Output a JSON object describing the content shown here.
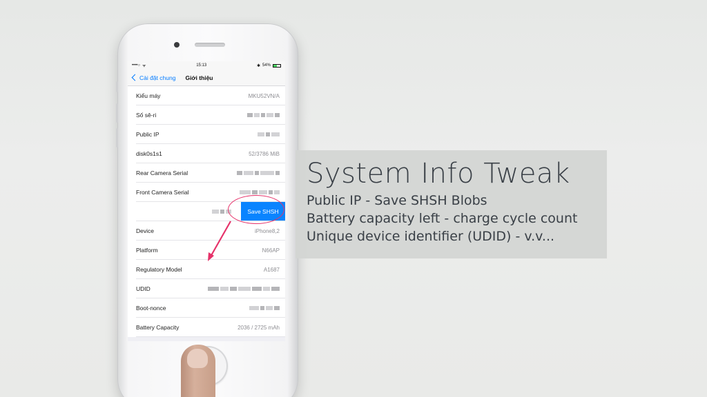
{
  "status_bar": {
    "signal": "••••○",
    "wifi": "ᯤ",
    "time": "15:13",
    "battery_percent": "54%",
    "battery_level": 0.54
  },
  "navbar": {
    "back_label": "Cài đặt chung",
    "title": "Giới thiệu"
  },
  "rows": [
    {
      "label": "Kiểu máy",
      "value": "MKU52VN/A"
    },
    {
      "label": "Số sê-ri",
      "value": ""
    },
    {
      "label": "Public IP",
      "value": ""
    },
    {
      "label": "disk0s1s1",
      "value": "52/3786 MiB"
    },
    {
      "label": "Rear Camera Serial",
      "value": ""
    },
    {
      "label": "Front Camera Serial",
      "value": ""
    },
    {
      "label": "",
      "value": ""
    },
    {
      "label": "Device",
      "value": "iPhone8,2"
    },
    {
      "label": "Platform",
      "value": "N66AP"
    },
    {
      "label": "Regulatory Model",
      "value": "A1687"
    },
    {
      "label": "UDID",
      "value": ""
    },
    {
      "label": "Boot-nonce",
      "value": ""
    },
    {
      "label": "Battery Capacity",
      "value": "2036 / 2725 mAh"
    }
  ],
  "save_button_label": "Save SHSH",
  "colors": {
    "accent": "#007aff",
    "save_button": "#0a84ff",
    "annotation": "#e6326a"
  },
  "overlay": {
    "title": "System Info Tweak",
    "lines": [
      "Public IP - Save SHSH Blobs",
      "Battery capacity left - charge cycle count",
      "Unique device identifier (UDID) - v.v..."
    ]
  }
}
